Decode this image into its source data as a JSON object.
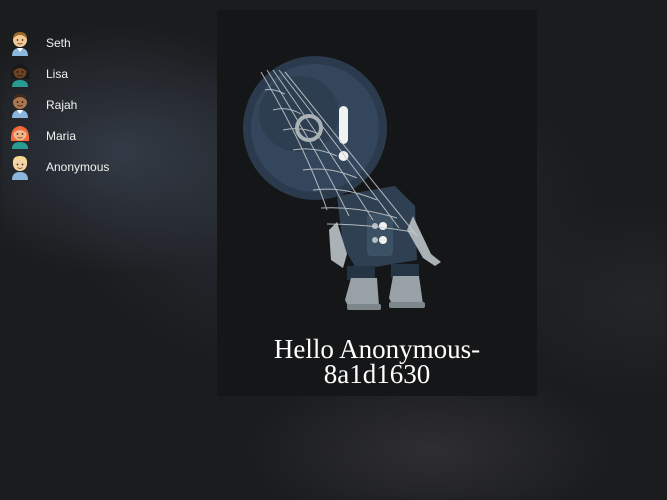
{
  "users": [
    {
      "name": "Seth",
      "avatar_icon": "man-emoji-icon",
      "skin": "#f1c898",
      "hair": "#9b6a2b"
    },
    {
      "name": "Lisa",
      "avatar_icon": "woman-emoji-icon",
      "skin": "#6d4326",
      "hair": "#181818"
    },
    {
      "name": "Rajah",
      "avatar_icon": "man-emoji-icon",
      "skin": "#ab7650",
      "hair": "#3f2a1d"
    },
    {
      "name": "Maria",
      "avatar_icon": "woman-emoji-icon",
      "skin": "#f0b891",
      "hair": "#ef6b3a"
    },
    {
      "name": "Anonymous",
      "avatar_icon": "person-emoji-icon",
      "skin": "#f3d4a8",
      "hair": "#f4db90"
    }
  ],
  "welcome": {
    "line1": "Hello Anonymous-",
    "line2": "8a1d1630",
    "illustration": "astronaut-in-web-icon"
  }
}
